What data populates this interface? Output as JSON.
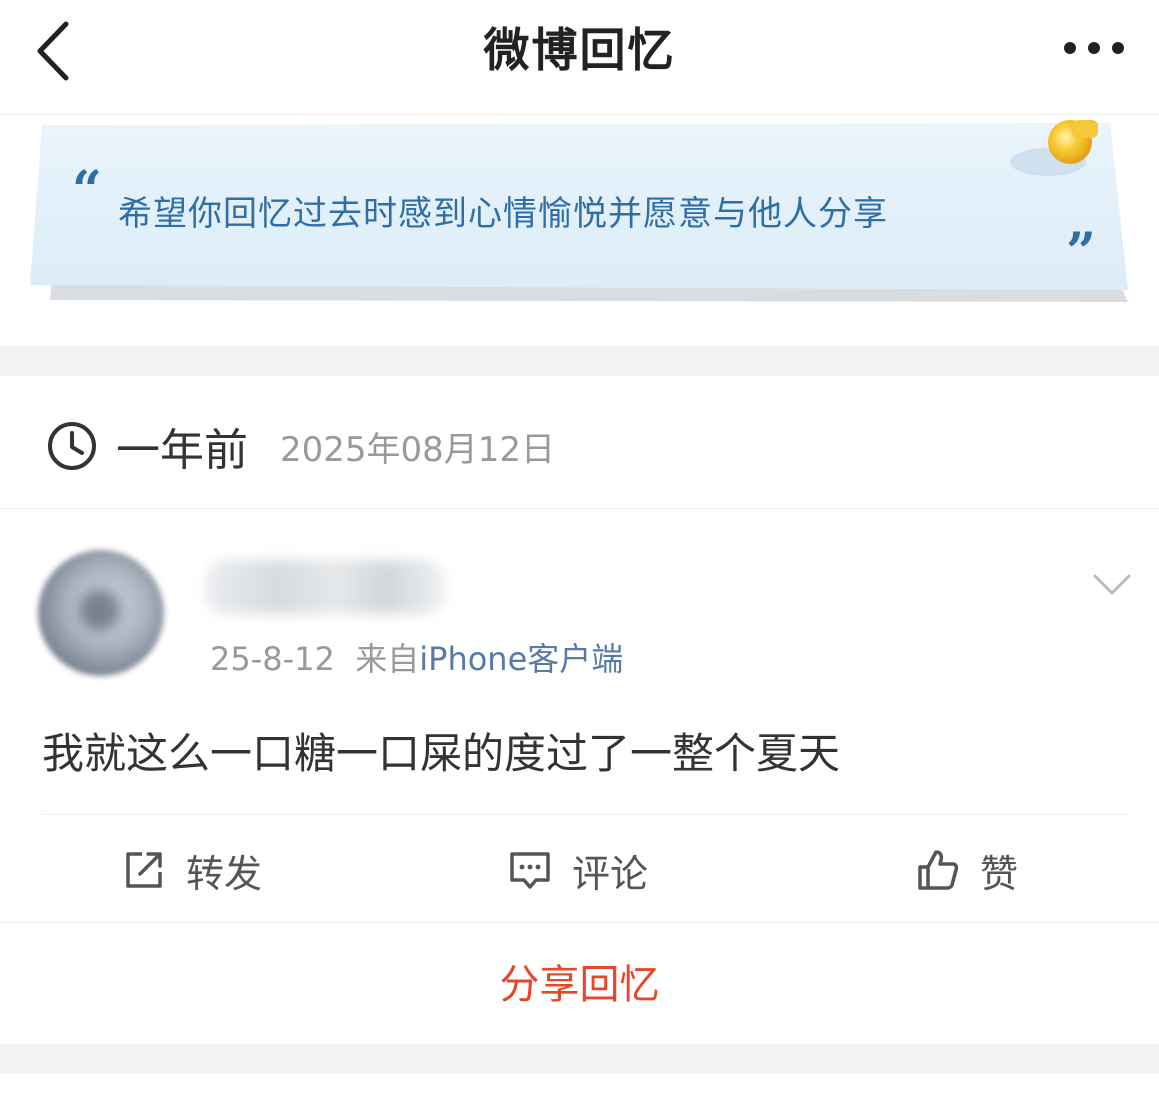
{
  "header": {
    "title": "微博回忆",
    "back_icon": "chevron-left-icon",
    "more_icon": "more-dots-icon"
  },
  "quote": {
    "open_mark": "“",
    "text": "希望你回忆过去时感到心情愉悦并愿意与他人分享",
    "close_mark": "”"
  },
  "memory": {
    "clock_icon": "clock-icon",
    "ago": "一年前",
    "date": "2025年08月12日"
  },
  "post": {
    "time": "25-8-12",
    "from_label": "来自",
    "source": "iPhone客户端",
    "text": "我就这么一口糖一口屎的度过了一整个夏天"
  },
  "actions": {
    "repost": "转发",
    "comment": "评论",
    "like": "赞"
  },
  "share_label": "分享回忆",
  "colors": {
    "accent_red": "#e8462a",
    "quote_blue": "#2f6fa8",
    "source_blue": "#5a7aa6"
  }
}
